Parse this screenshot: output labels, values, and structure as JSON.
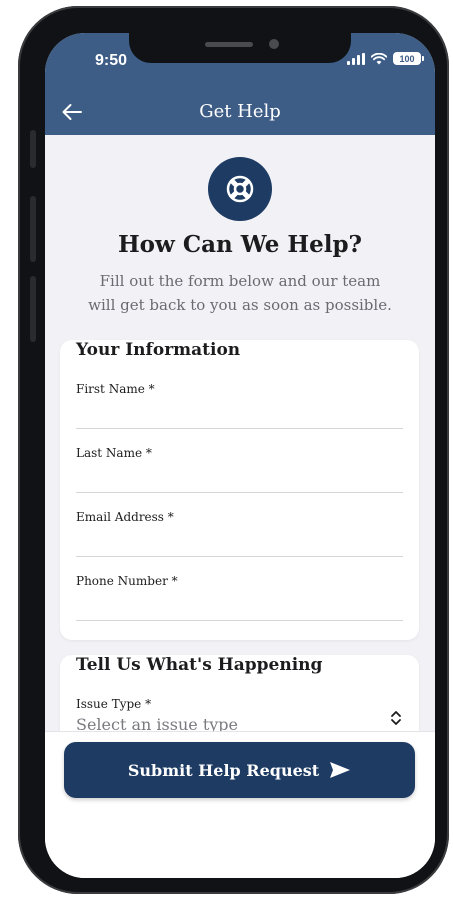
{
  "status_bar": {
    "time": "9:50",
    "battery": "100"
  },
  "nav": {
    "title": "Get Help",
    "back_icon": "arrow-left-icon"
  },
  "hero": {
    "icon": "lifebuoy-icon",
    "heading": "How Can We Help?",
    "subheading": "Fill out the form below and our team will get back to you as soon as possible."
  },
  "info_section": {
    "title": "Your Information",
    "fields": [
      {
        "label": "First Name *",
        "value": ""
      },
      {
        "label": "Last Name *",
        "value": ""
      },
      {
        "label": "Email Address *",
        "value": ""
      },
      {
        "label": "Phone Number *",
        "value": ""
      }
    ]
  },
  "issue_section": {
    "title": "Tell Us What's Happening",
    "issue_type_label": "Issue Type *",
    "issue_type_placeholder": "Select an issue type"
  },
  "actions": {
    "submit_label": "Submit Help Request",
    "submit_icon": "send-icon"
  },
  "colors": {
    "header": "#3d5d87",
    "primary": "#1d3b63",
    "background": "#f2f2f6"
  }
}
